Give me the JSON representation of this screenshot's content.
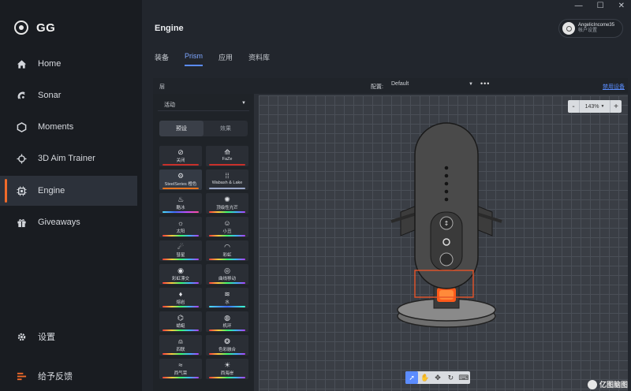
{
  "app": {
    "logo_text": "GG"
  },
  "window": {
    "minimize": "—",
    "maximize": "☐",
    "close": "✕"
  },
  "sidebar": {
    "items": [
      {
        "label": "Home",
        "icon": "home-icon"
      },
      {
        "label": "Sonar",
        "icon": "sonar-icon"
      },
      {
        "label": "Moments",
        "icon": "hexagon-icon"
      },
      {
        "label": "3D Aim Trainer",
        "icon": "crosshair-icon"
      },
      {
        "label": "Engine",
        "icon": "chip-icon"
      },
      {
        "label": "Giveaways",
        "icon": "gift-icon"
      }
    ],
    "settings_label": "设置",
    "feedback_label": "给予反馈"
  },
  "header": {
    "title": "Engine",
    "user_name": "AngelicIncome35",
    "user_sub": "帐户设置",
    "tabs": [
      "装备",
      "Prism",
      "应用",
      "资料库"
    ],
    "active_tab": "Prism"
  },
  "panel": {
    "layer_label": "层",
    "config_label": "配置:",
    "config_value": "Default",
    "more": "•••",
    "disable_link": "禁用设备",
    "activity": "活动",
    "seg_presets": "预设",
    "seg_effects": "效果",
    "tiles": [
      {
        "label": "关闭",
        "icon": "⊘",
        "bar": "#c8302a"
      },
      {
        "label": "FaZe",
        "icon": "⟰",
        "bar": "#c8302a"
      },
      {
        "label": "SteelSeries 橙色",
        "icon": "⚙",
        "bar": "#e8741e"
      },
      {
        "label": "Wabash & Lake",
        "icon": "⁞⁞",
        "bar": "#9aa7c8"
      },
      {
        "label": "酷冰",
        "icon": "♨",
        "bar": "linear-gradient(90deg,#4de0ff,#3f6bff,#c24dff,#ff4d9a)"
      },
      {
        "label": "顶级性光芒",
        "icon": "✺",
        "bar": "linear-gradient(90deg,#ff3b3b,#ffc93b,#3bff6b,#3bb5ff,#b43bff)"
      },
      {
        "label": "太阳",
        "icon": "☼",
        "bar": "linear-gradient(90deg,#ff3b3b,#ffc93b,#3bff6b,#3bb5ff,#b43bff)"
      },
      {
        "label": "小丑",
        "icon": "☺",
        "bar": "linear-gradient(90deg,#ff3b3b,#ffc93b,#3bff6b,#3bb5ff,#b43bff)"
      },
      {
        "label": "彗星",
        "icon": "☄",
        "bar": "linear-gradient(90deg,#ff3b3b,#ffc93b,#3bff6b,#3bb5ff,#b43bff)"
      },
      {
        "label": "彩虹",
        "icon": "◠",
        "bar": "linear-gradient(90deg,#ff3b3b,#ffc93b,#3bff6b,#3bb5ff,#b43bff)"
      },
      {
        "label": "彩虹漂交",
        "icon": "◉",
        "bar": "linear-gradient(90deg,#ff3b3b,#ffc93b,#3bff6b,#3bb5ff,#b43bff)"
      },
      {
        "label": "曲线移动",
        "icon": "◎",
        "bar": "linear-gradient(90deg,#ff3b3b,#ffc93b,#3bff6b,#3bb5ff,#b43bff)"
      },
      {
        "label": "熔岩",
        "icon": "♦",
        "bar": "linear-gradient(90deg,#ff3b3b,#ffc93b,#3bff6b,#3bb5ff,#b43bff)"
      },
      {
        "label": "水",
        "icon": "≋",
        "bar": "linear-gradient(90deg,#4de0ff,#3f6bff,#3bffd0)"
      },
      {
        "label": "蜻蜓",
        "icon": "⌬",
        "bar": "linear-gradient(90deg,#ff3b3b,#ffc93b,#3bff6b,#3bb5ff,#b43bff)"
      },
      {
        "label": "机环",
        "icon": "◍",
        "bar": "linear-gradient(90deg,#ff3b3b,#ffc93b,#3bff6b,#3bb5ff,#b43bff)"
      },
      {
        "label": "四联",
        "icon": "⍝",
        "bar": "linear-gradient(90deg,#ff3b3b,#ffc93b,#3bff6b,#3bb5ff,#b43bff)"
      },
      {
        "label": "色彩融合",
        "icon": "❂",
        "bar": "linear-gradient(90deg,#ff3b3b,#ffc93b,#3bff6b,#3bb5ff,#b43bff)"
      },
      {
        "label": "西气荣",
        "icon": "≈",
        "bar": "linear-gradient(90deg,#ff3b3b,#ffc93b,#3bff6b,#3bb5ff,#b43bff)"
      },
      {
        "label": "西海岸",
        "icon": "☀",
        "bar": "linear-gradient(90deg,#ff3b3b,#ffc93b,#3bff6b,#3bb5ff,#b43bff)"
      }
    ],
    "zoom": {
      "minus": "-",
      "value": "143%",
      "plus": "+"
    },
    "tools": [
      "select-icon",
      "hand-icon",
      "move-icon",
      "rotate-icon",
      "keyboard-icon"
    ]
  },
  "watermark": "亿图脑图"
}
